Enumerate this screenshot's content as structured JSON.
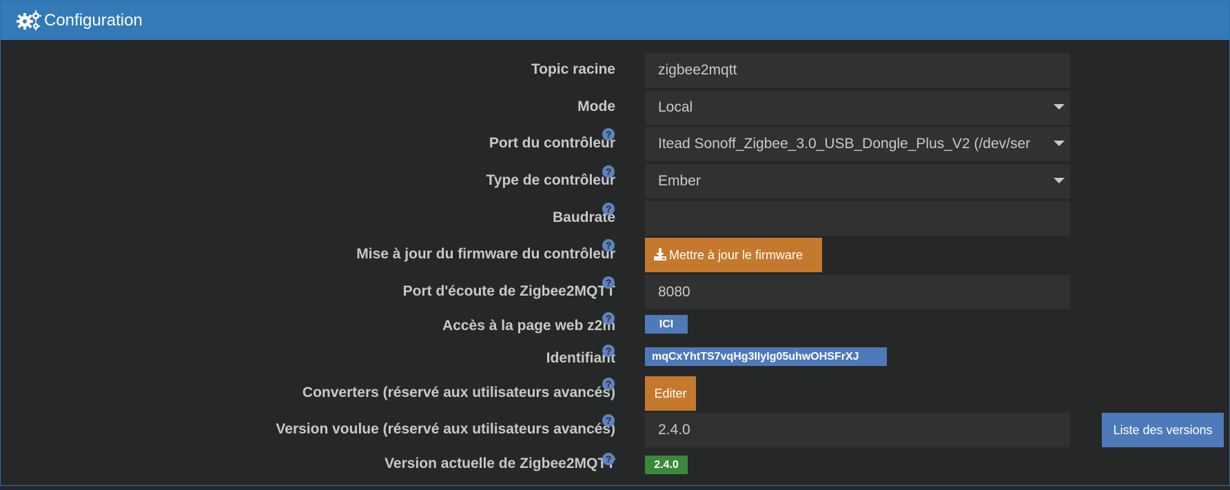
{
  "header": {
    "title": "Configuration",
    "icon": "gears-icon"
  },
  "colors": {
    "header": "#337ab7",
    "background": "#262828",
    "field": "#303232",
    "orange": "#c4792c",
    "blue": "#4f7ab9",
    "green": "#3a8a3b",
    "help": "#5b84c0"
  },
  "form": {
    "topic_racine": {
      "label": "Topic racine",
      "value": "zigbee2mqtt"
    },
    "mode": {
      "label": "Mode",
      "value": "Local"
    },
    "port_controleur": {
      "label": "Port du contrôleur",
      "value": "Itead Sonoff_Zigbee_3.0_USB_Dongle_Plus_V2 (/dev/ser"
    },
    "type_controleur": {
      "label": "Type de contrôleur",
      "value": "Ember"
    },
    "baudrate": {
      "label": "Baudrate",
      "value": ""
    },
    "firmware": {
      "label": "Mise à jour du firmware du contrôleur",
      "button": "Mettre à jour le firmware"
    },
    "port_ecoute": {
      "label": "Port d'écoute de Zigbee2MQTT",
      "value": "8080"
    },
    "acces_web": {
      "label": "Accès à la page web z2m",
      "badge": "ICI"
    },
    "identifiant": {
      "label": "Identifiant",
      "badge": "mqCxYhtTS7vqHg3IIyIg05uhwOHSFrXJ"
    },
    "converters": {
      "label": "Converters (réservé aux utilisateurs avancés)",
      "button": "Editer"
    },
    "version_voulue": {
      "label": "Version voulue (réservé aux utilisateurs avancés)",
      "value": "2.4.0",
      "button": "Liste des versions"
    },
    "version_actuelle": {
      "label": "Version actuelle de Zigbee2MQTT",
      "badge": "2.4.0"
    }
  }
}
